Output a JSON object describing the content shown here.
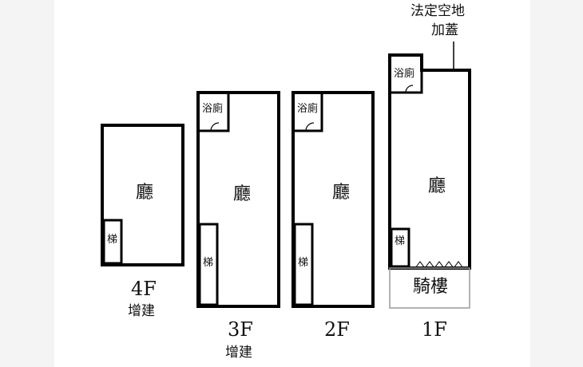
{
  "floors": {
    "f4": {
      "name": "4F",
      "note": "增建",
      "hall": "廳",
      "stair": "梯"
    },
    "f3": {
      "name": "3F",
      "note": "增建",
      "hall": "廳",
      "stair": "梯",
      "bath": "浴廁"
    },
    "f2": {
      "name": "2F",
      "hall": "廳",
      "stair": "梯",
      "bath": "浴廁"
    },
    "f1": {
      "name": "1F",
      "hall": "廳",
      "stair": "梯",
      "bath": "浴廁",
      "arcade": "騎樓"
    }
  },
  "annotation": {
    "line1": "法定空地",
    "line2": "加蓋"
  }
}
